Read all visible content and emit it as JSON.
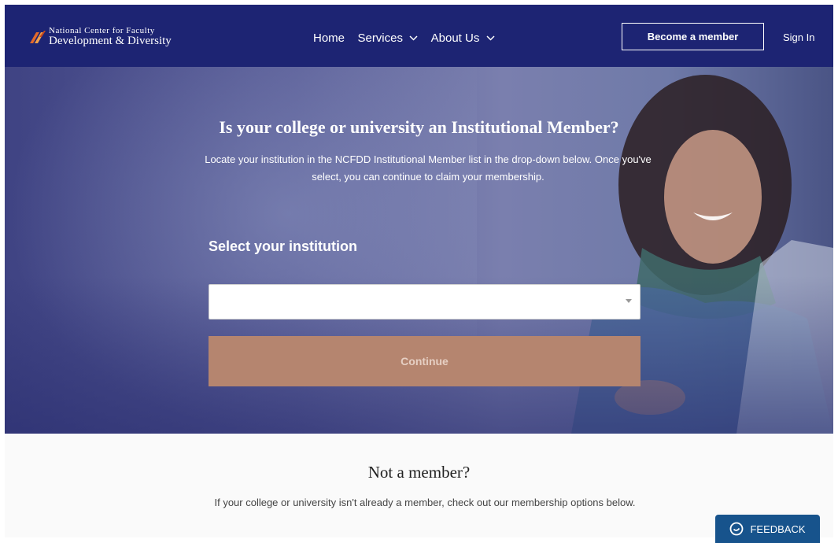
{
  "header": {
    "logo_line1": "National Center for Faculty",
    "logo_line2": "Development & Diversity",
    "nav": [
      {
        "label": "Home",
        "has_chevron": false
      },
      {
        "label": "Services",
        "has_chevron": true
      },
      {
        "label": "About Us",
        "has_chevron": true
      }
    ],
    "become_member_label": "Become a member",
    "sign_in_label": "Sign In"
  },
  "hero": {
    "title": "Is your college or university an Institutional Member?",
    "description": "Locate your institution in the NCFDD Institutional Member list in the drop-down below. Once you've select, you can continue to claim your membership.",
    "select_label": "Select your institution",
    "select_value": "",
    "continue_label": "Continue"
  },
  "not_member": {
    "title": "Not a member?",
    "text": "If your college or university isn't already a member, check out our membership options below."
  },
  "feedback": {
    "label": "FEEDBACK"
  },
  "colors": {
    "header_bg": "#1d2473",
    "continue_bg": "#b5856f",
    "feedback_bg": "#17538c"
  }
}
